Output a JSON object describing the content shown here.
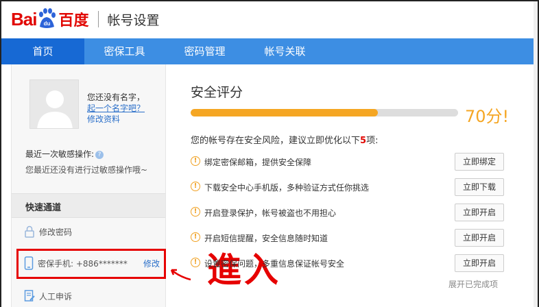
{
  "header": {
    "logo_bai": "Bai",
    "logo_du": "du",
    "logo_cn": "百度",
    "title": "帐号设置"
  },
  "nav": {
    "items": [
      "首页",
      "密保工具",
      "密码管理",
      "帐号关联"
    ]
  },
  "sidebar": {
    "name_prompt": "您还没有名字，",
    "name_link": "起一个名字吧？",
    "edit_profile": "修改资料",
    "sensitive_title": "最近一次敏感操作:",
    "sensitive_text": "您最近还没有进行过敏感操作哦~",
    "quick_title": "快速通道",
    "change_password": "修改密码",
    "phone_label": "密保手机: +886*******",
    "phone_edit": "修改",
    "appeal": "人工申诉"
  },
  "annotation": {
    "label": "進入"
  },
  "main": {
    "score_title": "安全评分",
    "score_text": "70分!",
    "score_value": 70,
    "risk_prefix": "您的帐号存在安全风险，建议立即优化以下",
    "risk_count": "5",
    "risk_suffix": "项:",
    "rows": [
      {
        "text": "绑定密保邮箱，提供安全保障",
        "button": "立即绑定"
      },
      {
        "text": "下载安全中心手机版，多种验证方式任你挑选",
        "button": "立即下载"
      },
      {
        "text": "开启登录保护，帐号被盗也不用担心",
        "button": "立即开启"
      },
      {
        "text": "开启短信提醒，安全信息随时知道",
        "button": "立即开启"
      },
      {
        "text": "设置密保问题，多重信息保证帐号安全",
        "button": "立即开启"
      }
    ],
    "expand": "展开已完成项"
  },
  "colors": {
    "brand_red": "#e10601",
    "nav_blue": "#3d8ee3",
    "nav_active": "#1769d4",
    "score_orange": "#f5a623",
    "highlight": "#e60000"
  }
}
